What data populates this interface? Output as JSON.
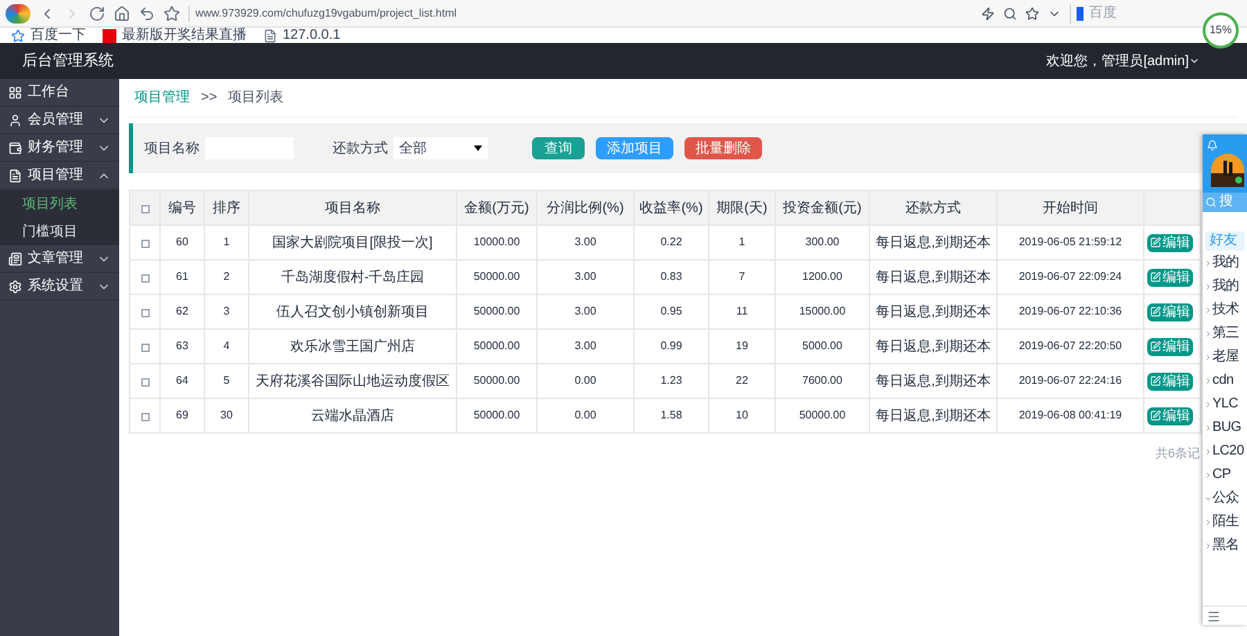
{
  "browser": {
    "url": "www.973929.com/chufuzg19vgabum/project_list.html",
    "search_placeholder": "百度",
    "speed_badge": "15%",
    "bookmarks": [
      {
        "label": "百度一下",
        "kind": "star"
      },
      {
        "label": "最新版开奖结果直播",
        "kind": "logo"
      },
      {
        "label": "127.0.0.1",
        "kind": "page"
      }
    ]
  },
  "header": {
    "title": "后台管理系统",
    "user": "欢迎您，管理员[admin]"
  },
  "sidebar": {
    "items": [
      {
        "label": "工作台",
        "kind": "link"
      },
      {
        "label": "会员管理",
        "kind": "group",
        "expanded": false
      },
      {
        "label": "财务管理",
        "kind": "group",
        "expanded": false
      },
      {
        "label": "项目管理",
        "kind": "group",
        "expanded": true,
        "children": [
          {
            "label": "项目列表",
            "selected": true
          },
          {
            "label": "门槛项目",
            "selected": false
          }
        ]
      },
      {
        "label": "文章管理",
        "kind": "group",
        "expanded": false
      },
      {
        "label": "系统设置",
        "kind": "group",
        "expanded": false
      }
    ]
  },
  "breadcrumb": [
    "项目管理",
    ">>",
    "项目列表"
  ],
  "filter": {
    "name_label": "项目名称",
    "repay_label": "还款方式",
    "repay_value": "全部",
    "buttons": [
      {
        "label": "查询",
        "color": "#1aa094"
      },
      {
        "label": "添加项目",
        "color": "#2d9eff"
      },
      {
        "label": "批量删除",
        "color": "#e0574a"
      }
    ]
  },
  "table": {
    "select_all_checked": false,
    "columns": [
      "编号",
      "排序",
      "项目名称",
      "金额(万元)",
      "分润比例(%)",
      "收益率(%)",
      "期限(天)",
      "投资金额(元)",
      "还款方式",
      "开始时间"
    ],
    "rows": [
      {
        "checked": false,
        "cells": [
          "60",
          "1",
          "国家大剧院项目[限投一次]",
          "10000.00",
          "3.00",
          "0.22",
          "1",
          "300.00",
          "每日返息,到期还本",
          "2019-06-05 21:59:12"
        ],
        "action": "编辑"
      },
      {
        "checked": false,
        "cells": [
          "61",
          "2",
          "千岛湖度假村-千岛庄园",
          "50000.00",
          "3.00",
          "0.83",
          "7",
          "1200.00",
          "每日返息,到期还本",
          "2019-06-07 22:09:24"
        ],
        "action": "编辑"
      },
      {
        "checked": false,
        "cells": [
          "62",
          "3",
          "伍人召文创小镇创新项目",
          "50000.00",
          "3.00",
          "0.95",
          "11",
          "15000.00",
          "每日返息,到期还本",
          "2019-06-07 22:10:36"
        ],
        "action": "编辑"
      },
      {
        "checked": false,
        "cells": [
          "63",
          "4",
          "欢乐冰雪王国广州店",
          "50000.00",
          "3.00",
          "0.99",
          "19",
          "5000.00",
          "每日返息,到期还本",
          "2019-06-07 22:20:50"
        ],
        "action": "编辑"
      },
      {
        "checked": false,
        "cells": [
          "64",
          "5",
          "天府花溪谷国际山地运动度假区",
          "50000.00",
          "0.00",
          "1.23",
          "22",
          "7600.00",
          "每日返息,到期还本",
          "2019-06-07 22:24:16"
        ],
        "action": "编辑"
      },
      {
        "checked": false,
        "cells": [
          "69",
          "30",
          "云端水晶酒店",
          "50000.00",
          "0.00",
          "1.58",
          "10",
          "50000.00",
          "每日返息,到期还本",
          "2019-06-08 00:41:19"
        ],
        "action": "编辑"
      }
    ]
  },
  "pagination": "共6条记",
  "qq_panel": {
    "search": "搜",
    "tab": "好友",
    "groups": [
      {
        "label": "我的",
        "expanded": false
      },
      {
        "label": "我的",
        "expanded": false
      },
      {
        "label": "技术",
        "expanded": false
      },
      {
        "label": "第三",
        "expanded": false
      },
      {
        "label": "老屋",
        "expanded": false
      },
      {
        "label": "cdn",
        "expanded": false
      },
      {
        "label": "YLC",
        "expanded": false
      },
      {
        "label": "BUG",
        "expanded": false
      },
      {
        "label": "LC20",
        "expanded": false
      },
      {
        "label": "CP",
        "expanded": false
      },
      {
        "label": "公众",
        "expanded": true
      },
      {
        "label": "陌生",
        "expanded": false
      },
      {
        "label": "黑名",
        "expanded": false
      }
    ]
  }
}
